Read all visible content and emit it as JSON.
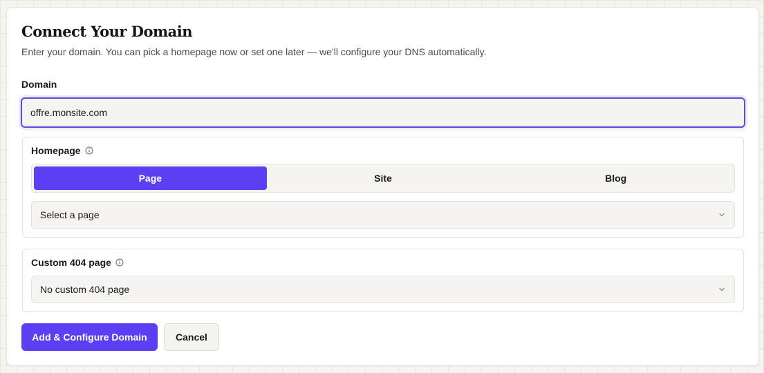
{
  "dialog": {
    "title": "Connect Your Domain",
    "subtitle": "Enter your domain. You can pick a homepage now or set one later — we'll configure your DNS automatically."
  },
  "domain": {
    "label": "Domain",
    "value": "offre.monsite.com"
  },
  "homepage": {
    "label": "Homepage",
    "info_icon": "info-icon",
    "options": [
      {
        "label": "Page",
        "active": true
      },
      {
        "label": "Site",
        "active": false
      },
      {
        "label": "Blog",
        "active": false
      }
    ],
    "select_value": "Select a page"
  },
  "custom_404": {
    "label": "Custom 404 page",
    "info_icon": "info-icon",
    "select_value": "No custom 404 page"
  },
  "actions": {
    "primary_label": "Add & Configure Domain",
    "cancel_label": "Cancel"
  },
  "colors": {
    "accent": "#5b3ff2",
    "focus_border": "#5b4bd6",
    "field_background": "#f5f4f0",
    "border": "#e3e1dc"
  }
}
